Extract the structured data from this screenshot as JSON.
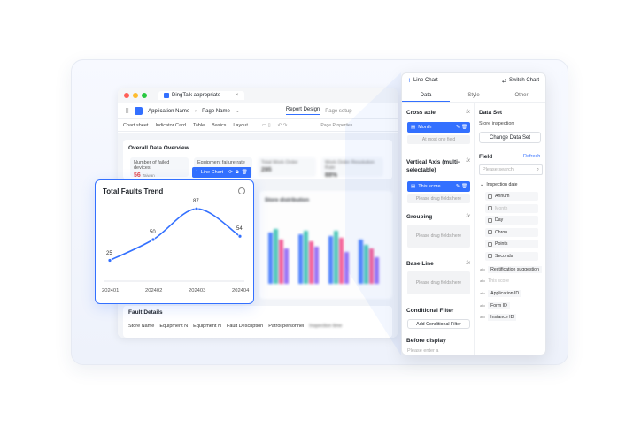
{
  "window": {
    "tab_title": "DingTalk appropriate",
    "app_name": "Application Name",
    "page_name": "Page Name",
    "report_design": "Report Design",
    "page_setup": "Page setup",
    "page_properties": "Page Properties"
  },
  "toolbar": {
    "items": [
      "Chart sheet",
      "Indicator Card",
      "Table",
      "Basics",
      "Layout"
    ]
  },
  "overview": {
    "title": "Overall Data Overview",
    "metrics": [
      {
        "label": "Number of failed devices",
        "value": "56",
        "unit": "Taiwan"
      },
      {
        "label": "Equipment failure rate",
        "value": ""
      },
      {
        "label": "Total Work Order",
        "value": "295"
      },
      {
        "label": "Work Order Resolution Rate",
        "value": "88%"
      }
    ]
  },
  "store": {
    "title": "Store distribution"
  },
  "fault": {
    "title": "Fault Details",
    "columns": [
      "Store Name",
      "Equipment N",
      "Equipment N",
      "Fault Description",
      "Patrol personnel",
      "Inspection time"
    ]
  },
  "line_chart_button": "Line Chart",
  "popup": {
    "title": "Total Faults Trend"
  },
  "chart_data": {
    "type": "line",
    "title": "Total Faults Trend",
    "categories": [
      "202401",
      "202402",
      "202403",
      "202404"
    ],
    "values": [
      25,
      50,
      87,
      54
    ],
    "xlabel": "",
    "ylabel": "",
    "ylim": [
      0,
      100
    ],
    "grid": false,
    "legend": "none"
  },
  "panel": {
    "header": "Line Chart",
    "switch": "Switch Chart",
    "tabs": [
      "Data",
      "Style",
      "Other"
    ],
    "cross_axle": "Cross axle",
    "month_chip": "Month",
    "at_most_one": "At most one field",
    "vertical_axis": "Vertical Axis (multi-selectable)",
    "score_chip": "This score",
    "drag_hint": "Please drag fields here",
    "grouping": "Grouping",
    "grouping_hint": "Please drag fields here",
    "baseline": "Base Line",
    "baseline_hint": "Please drag fields here",
    "conditional": "Conditional Filter",
    "add_conditional": "Add Conditional Filter",
    "before_display": "Before display",
    "before_hint": "Please enter a",
    "dataset": "Data Set",
    "store_inspection": "Store inspection",
    "change_dataset": "Change Data Set",
    "field": "Field",
    "refresh": "Refresh",
    "search_placeholder": "Please search",
    "inspection_date": "Inspection date",
    "date_fields": [
      "Annum",
      "Month",
      "Day",
      "Chron",
      "Points",
      "Seconds"
    ],
    "other_fields": [
      "Rectification suggestion",
      "This score",
      "Application ID",
      "Form ID",
      "Instance ID"
    ]
  },
  "colors": {
    "accent": "#3370ff"
  }
}
